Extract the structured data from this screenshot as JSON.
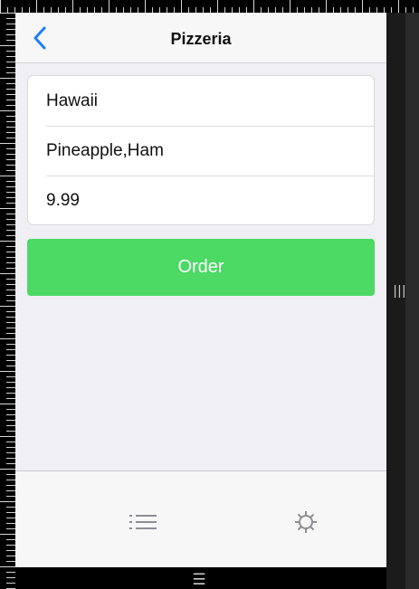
{
  "nav": {
    "title": "Pizzeria",
    "back_icon": "chevron-left-icon"
  },
  "pizza": {
    "name": "Hawaii",
    "toppings": "Pineapple,Ham",
    "price": "9.99"
  },
  "actions": {
    "order_label": "Order"
  },
  "tabbar": {
    "items": [
      {
        "icon": "list-icon"
      },
      {
        "icon": "gear-icon"
      }
    ]
  },
  "colors": {
    "accent": "#1d7ffd",
    "order_button": "#4cd964",
    "screen_background": "#efeff4"
  }
}
